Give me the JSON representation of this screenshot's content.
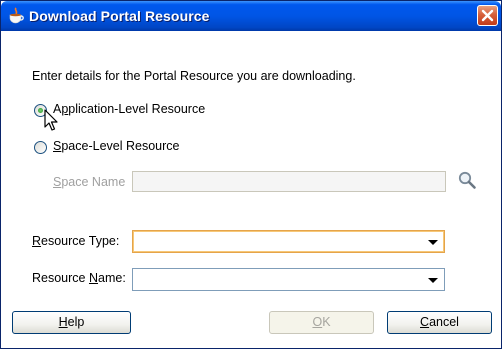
{
  "window": {
    "title": "Download Portal Resource",
    "icon": "oracle-cup-icon",
    "close_icon": "close-icon"
  },
  "intro_text": "Enter details for the Portal Resource you are downloading.",
  "options": {
    "app_level": {
      "pre": "A",
      "mnemonic": "p",
      "post": "plication-Level Resource",
      "checked": true
    },
    "space_level": {
      "mnemonic": "S",
      "post": "pace-Level Resource",
      "checked": false
    }
  },
  "space_name": {
    "mnemonic": "S",
    "post": "pace Name",
    "value": "",
    "enabled": false,
    "search_icon": "search-icon"
  },
  "resource_type": {
    "mnemonic": "R",
    "post": "esource Type:",
    "value": ""
  },
  "resource_name": {
    "pre": "Resource ",
    "mnemonic": "N",
    "post": "ame:",
    "value": ""
  },
  "buttons": {
    "help": {
      "mnemonic": "H",
      "post": "elp"
    },
    "ok": {
      "mnemonic": "O",
      "post": "K",
      "enabled": false
    },
    "cancel": {
      "mnemonic": "C",
      "post": "ancel"
    }
  },
  "colors": {
    "title_bar": "#0055e5",
    "close_button": "#d7603b",
    "focus_border": "#e5a44a",
    "radio_dot": "#21a121"
  }
}
